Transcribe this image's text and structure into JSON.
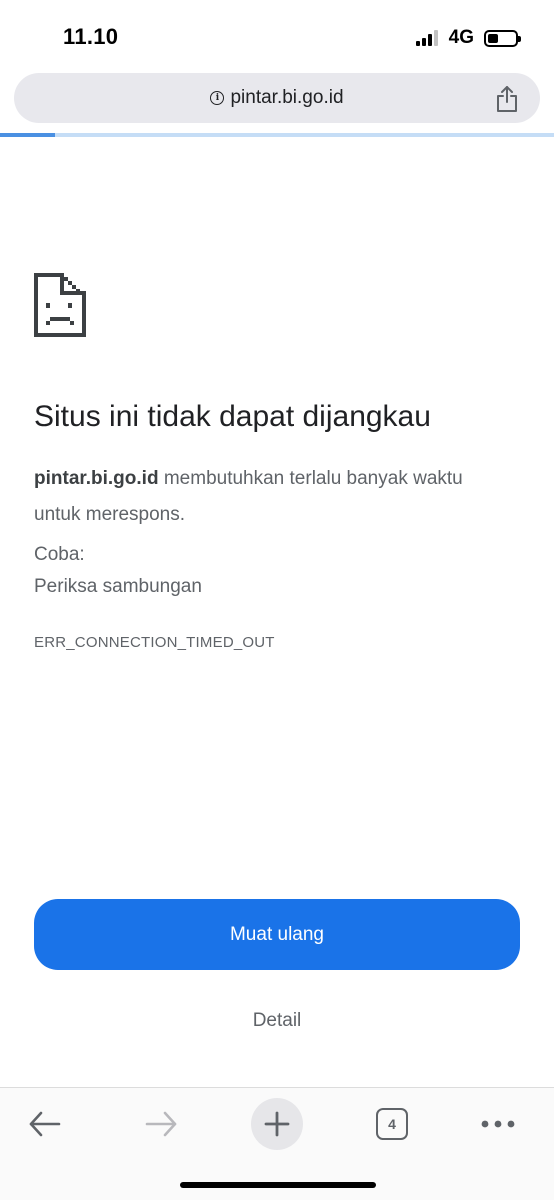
{
  "status_bar": {
    "time": "11.10",
    "network": "4G",
    "battery_level_percent": 40
  },
  "address_bar": {
    "url": "pintar.bi.go.id",
    "info_icon": "info-icon",
    "share_icon": "share-icon"
  },
  "loading_progress_percent": 10,
  "error": {
    "icon": "sad-page-icon",
    "title": "Situs ini tidak dapat dijangkau",
    "host": "pintar.bi.go.id",
    "message": " membutuhkan terlalu banyak waktu untuk merespons.",
    "try_label": "Coba:",
    "suggestion": "Periksa sambungan",
    "code": "ERR_CONNECTION_TIMED_OUT"
  },
  "buttons": {
    "reload": "Muat ulang",
    "details": "Detail"
  },
  "toolbar": {
    "back_icon": "back-arrow-icon",
    "forward_icon": "forward-arrow-icon",
    "new_tab_icon": "plus-icon",
    "tab_count": "4",
    "more_icon": "more-icon"
  },
  "colors": {
    "accent": "#1a73e8",
    "progress": "#4a90e2",
    "text_secondary": "#5f6368"
  }
}
